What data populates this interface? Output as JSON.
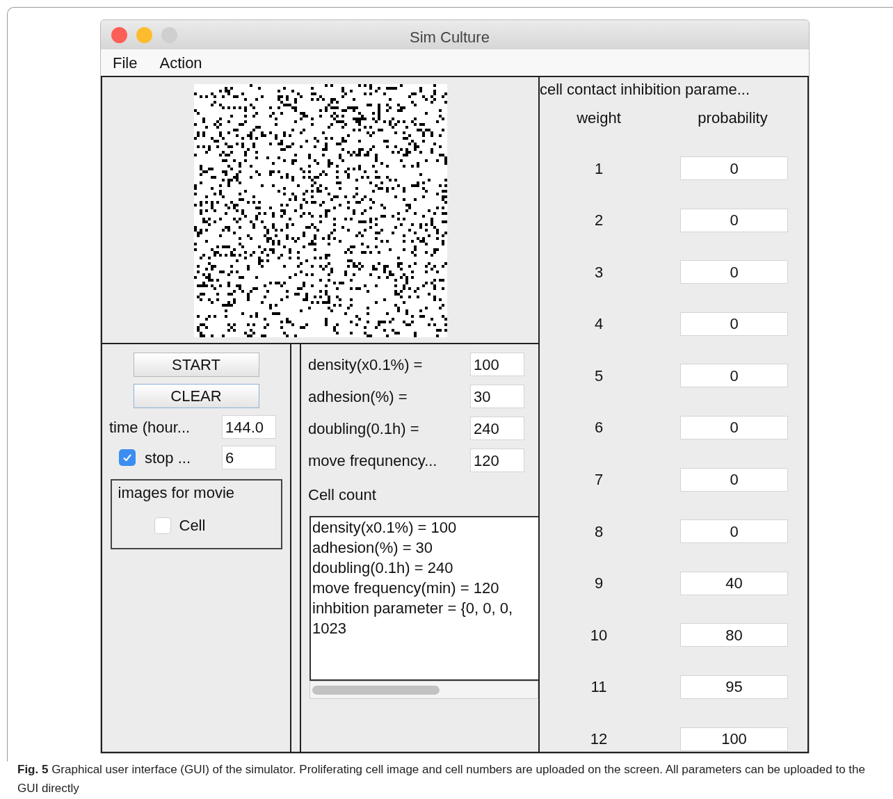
{
  "window": {
    "title": "Sim Culture"
  },
  "menu": [
    "File",
    "Action"
  ],
  "run_panel": {
    "buttons": [
      {
        "label": "START",
        "focused": false
      },
      {
        "label": "CLEAR",
        "focused": true
      }
    ],
    "time": {
      "label": "time (hour...",
      "value": "144.0"
    },
    "stop": {
      "label": "stop ...",
      "checked": true,
      "value": "6"
    },
    "movie_group": {
      "title": "images for movie",
      "options": [
        {
          "label": "Cell",
          "checked": false
        }
      ]
    }
  },
  "parameters": [
    {
      "label": "density(x0.1%) =",
      "value": "100"
    },
    {
      "label": "adhesion(%) =",
      "value": "30"
    },
    {
      "label": "doubling(0.1h) =",
      "value": "240"
    },
    {
      "label": "move frequnency...",
      "value": "120"
    }
  ],
  "cell_count_label": "Cell count",
  "log_lines": [
    "density(x0.1%) = 100",
    "adhesion(%) = 30",
    "doubling(0.1h) = 240",
    "move frequency(min) = 120",
    "inhbition parameter = {0, 0, 0,",
    "1023"
  ],
  "inhibition": {
    "title": "cell contact inhibition parame...",
    "columns": [
      "weight",
      "probability"
    ],
    "rows": [
      {
        "weight": "1",
        "probability": "0"
      },
      {
        "weight": "2",
        "probability": "0"
      },
      {
        "weight": "3",
        "probability": "0"
      },
      {
        "weight": "4",
        "probability": "0"
      },
      {
        "weight": "5",
        "probability": "0"
      },
      {
        "weight": "6",
        "probability": "0"
      },
      {
        "weight": "7",
        "probability": "0"
      },
      {
        "weight": "8",
        "probability": "0"
      },
      {
        "weight": "9",
        "probability": "40"
      },
      {
        "weight": "10",
        "probability": "80"
      },
      {
        "weight": "11",
        "probability": "95"
      },
      {
        "weight": "12",
        "probability": "100"
      }
    ]
  },
  "caption": "**Fig. 5**  Graphical user interface (GUI) of the simulator. Proliferating cell image and cell numbers are uploaded on the screen. All parameters can be uploaded to the GUI directly"
}
